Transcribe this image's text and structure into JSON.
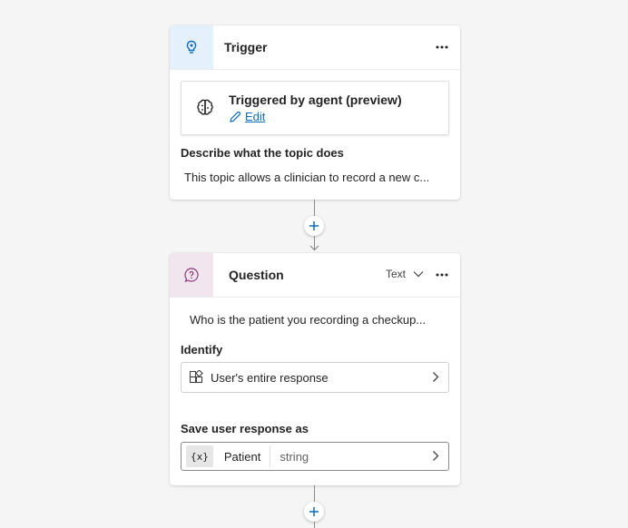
{
  "trigger_node": {
    "title": "Trigger",
    "agent_box": {
      "title": "Triggered by agent (preview)",
      "edit_label": "Edit"
    },
    "describe_label": "Describe what the topic does",
    "description": "This topic allows a clinician to record a new c..."
  },
  "question_node": {
    "title": "Question",
    "type_select": "Text",
    "prompt": "Who is the patient you recording a checkup...",
    "identify_label": "Identify",
    "identify_value": "User's entire response",
    "save_label": "Save user response as",
    "variable": {
      "badge": "{x}",
      "name": "Patient",
      "type": "string"
    }
  },
  "icons": {
    "trigger": "lightbulb-icon",
    "agent": "brain-icon",
    "edit": "pencil-icon",
    "question": "question-bubble-icon",
    "identify": "entity-grid-icon",
    "more": "more-horizontal-icon",
    "chevron": "chevron-right-icon",
    "add": "plus-icon"
  },
  "colors": {
    "trigger_icon": "#0f6cbd",
    "question_icon": "#8c3b7a",
    "link": "#0f6cbd",
    "add_button": "#0f6cbd"
  }
}
